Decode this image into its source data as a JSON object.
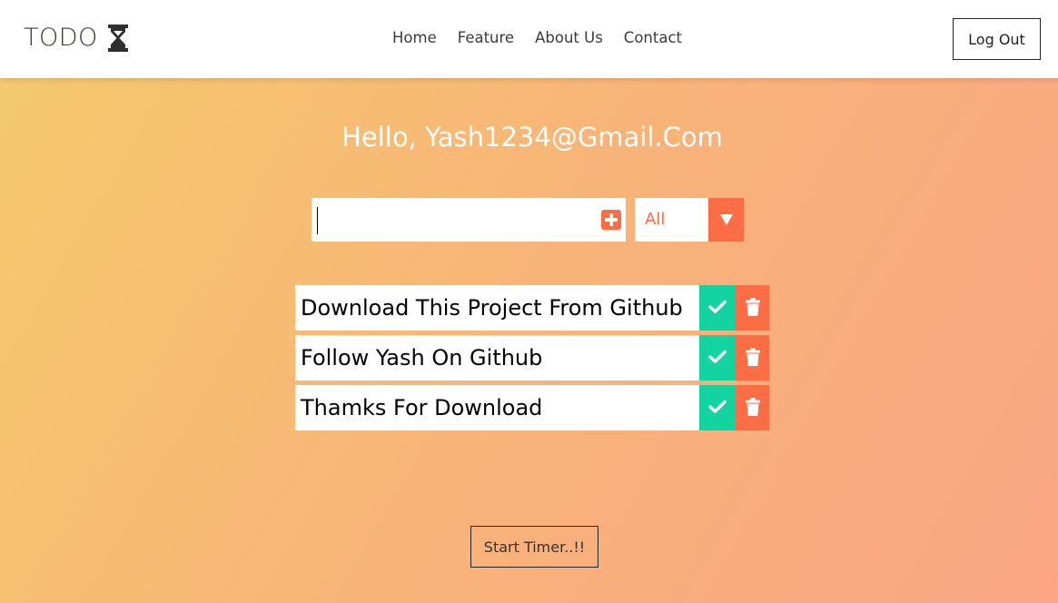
{
  "brand": {
    "name": "TODO",
    "icon": "hourglass-icon"
  },
  "nav": {
    "links": [
      "Home",
      "Feature",
      "About Us",
      "Contact"
    ]
  },
  "header": {
    "logout_label": "Log Out"
  },
  "main": {
    "greeting": "Hello, Yash1234@Gmail.Com",
    "input": {
      "value": "",
      "placeholder": "",
      "add_icon": "plus-square-icon"
    },
    "filter": {
      "selected": "All",
      "arrow_icon": "caret-down-icon"
    },
    "todos": [
      {
        "text": "Download This Project From Github"
      },
      {
        "text": "Follow Yash On Github"
      },
      {
        "text": "Thamks For Download"
      }
    ],
    "timer_label": "Start Timer..!!"
  },
  "colors": {
    "accent_orange": "#fb6d45",
    "accent_green": "#13d3a0",
    "gradient_start": "#f4ca6c",
    "gradient_end": "#fba585"
  }
}
